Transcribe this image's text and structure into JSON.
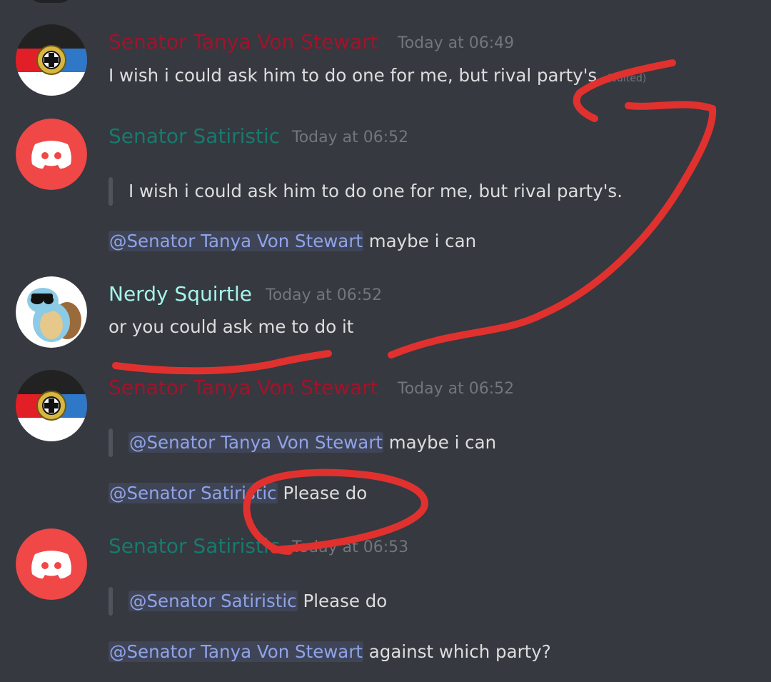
{
  "colors": {
    "background": "#36393f",
    "author_red": "#a3122b",
    "author_teal": "#177a6f",
    "author_cyan": "#a4f4ec",
    "mention_text": "#8fa3e8",
    "scribble": "#e0312f"
  },
  "messages": [
    {
      "author": "Senator Tanya Von Stewart",
      "timestamp": "Today at 06:49",
      "avatar": "flag-eagle-avatar",
      "text": "I wish i could ask him to do one for me, but rival party's.",
      "edited_label": "(edited)"
    },
    {
      "author": "Senator Satiristic",
      "timestamp": "Today at 06:52",
      "avatar": "discord-logo-avatar",
      "quote": "I wish i could ask him to do one for me, but rival party's.",
      "mention": "@Senator Tanya Von Stewart",
      "text": "maybe i can"
    },
    {
      "author": "Nerdy Squirtle",
      "timestamp": "Today at 06:52",
      "avatar": "squirtle-sunglasses-avatar",
      "text": "or you could ask me to do it"
    },
    {
      "author": "Senator Tanya Von Stewart",
      "timestamp": "Today at 06:52",
      "avatar": "flag-eagle-avatar",
      "quote_mention": "@Senator Tanya Von Stewart",
      "quote_text": "maybe i can",
      "mention": "@Senator Satiristic",
      "text": "Please do"
    },
    {
      "author": "Senator Satiristic",
      "timestamp": "Today at 06:53",
      "avatar": "discord-logo-avatar",
      "quote_mention": "@Senator Satiristic",
      "quote_text": "Please do",
      "mention": "@Senator Tanya Von Stewart",
      "text": "against which party?"
    }
  ]
}
